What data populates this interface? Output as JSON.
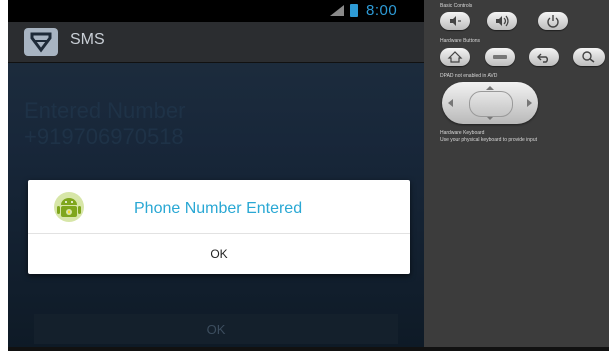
{
  "status_bar": {
    "time": "8:00"
  },
  "action_bar": {
    "title": "SMS"
  },
  "main": {
    "entered_label": "Entered Number",
    "entered_value": "+919706970518",
    "bottom_button_label": "OK"
  },
  "dialog": {
    "title": "Phone Number Entered",
    "ok_label": "OK"
  },
  "controls": {
    "basic_controls_label": "Basic Controls",
    "hardware_buttons_label": "Hardware Buttons",
    "dpad_label": "DPAD not enabled in AVD",
    "keyboard_label": "Hardware Keyboard",
    "keyboard_note": "Use your physical keyboard to provide input"
  },
  "colors": {
    "accent": "#2aa8d4",
    "status_blue": "#2e9bd6"
  }
}
